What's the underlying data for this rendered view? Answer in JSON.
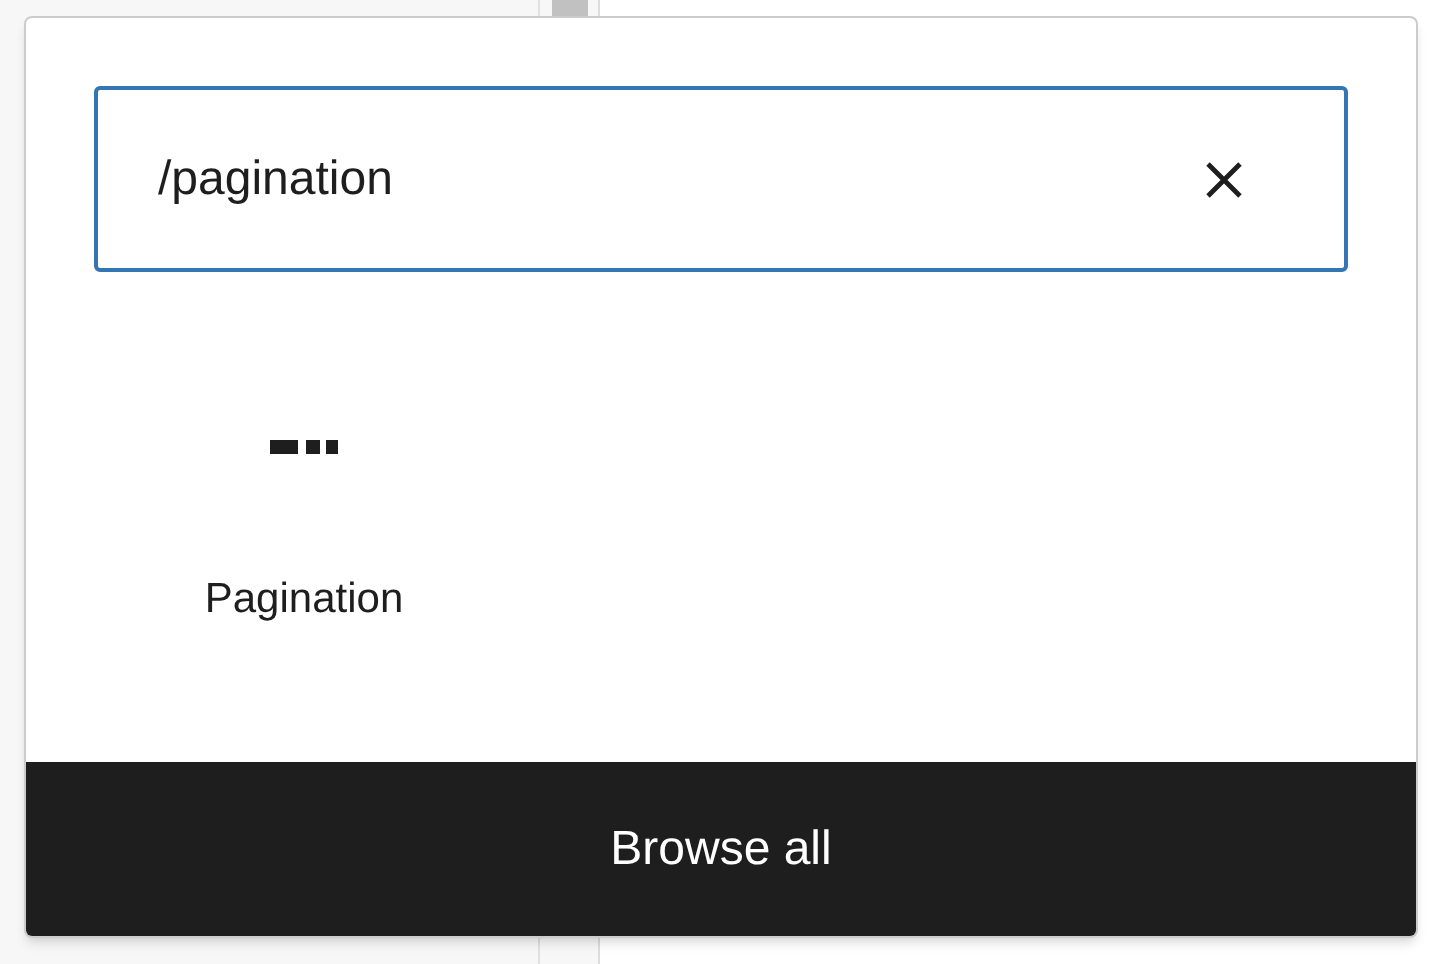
{
  "search": {
    "value": "/pagination"
  },
  "results": [
    {
      "label": "Pagination"
    }
  ],
  "footer_button": {
    "label": "Browse all"
  }
}
